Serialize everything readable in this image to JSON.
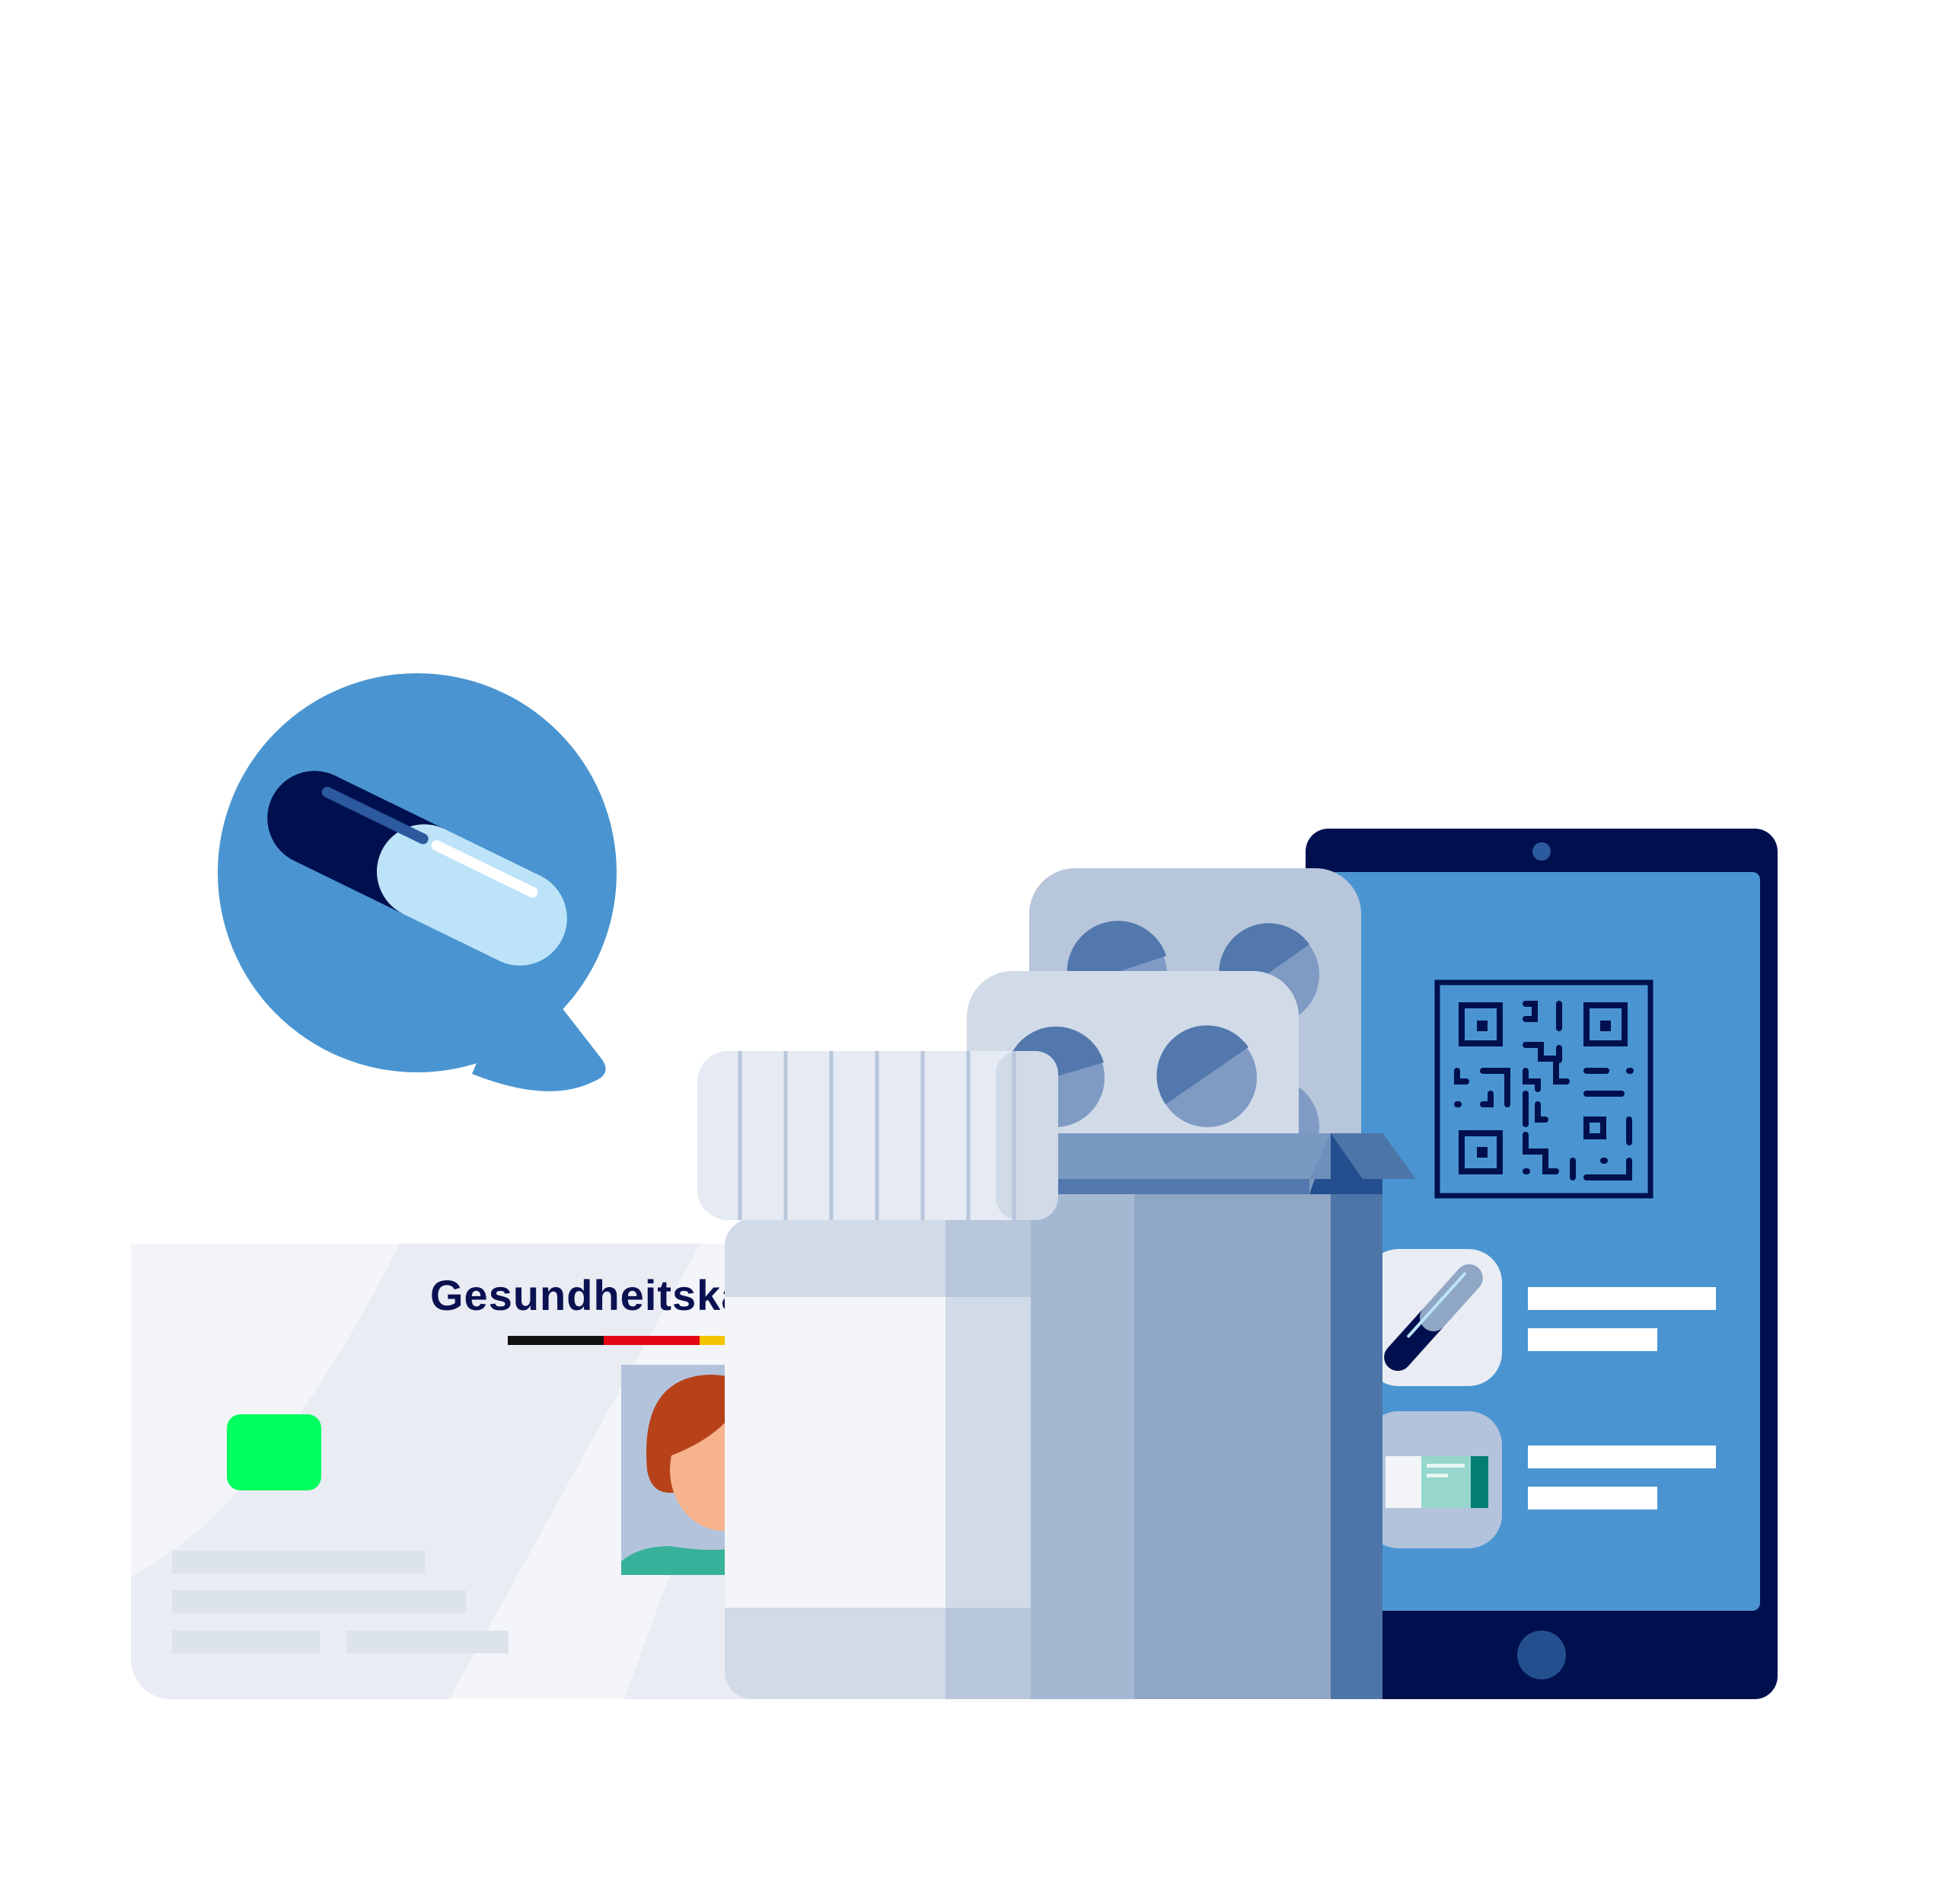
{
  "card": {
    "title": "Gesundheitskarte"
  },
  "colors": {
    "navy": "#00104f",
    "bubble_blue": "#4a95d1",
    "chip_green": "#00ff5f",
    "card_bg": "#e9ecf3",
    "tablet_screen": "#4a95d1",
    "box_blue": "#8fa6c4",
    "flag_black": "#111111",
    "flag_red": "#e30613",
    "flag_gold": "#f5c400"
  },
  "icons": {
    "speech_bubble": "capsule-speech-bubble-icon",
    "card_chip": "sim-chip-icon",
    "qr_code": "qr-code-icon",
    "capsule_tile": "capsule-icon",
    "medicine_pack_tile": "medicine-pack-icon",
    "tablet_camera": "camera-icon",
    "tablet_home": "home-button-icon"
  }
}
